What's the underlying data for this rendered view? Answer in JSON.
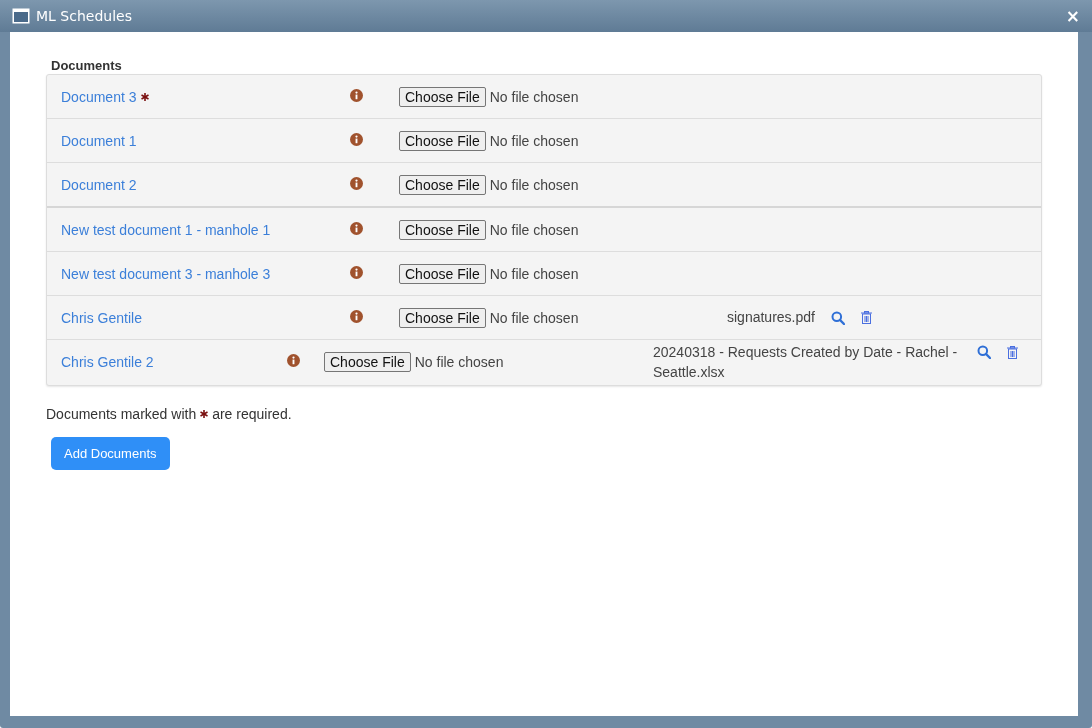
{
  "window": {
    "title": "ML Schedules",
    "close": "×"
  },
  "section_title": "Documents",
  "rows": [
    {
      "kind": "standard",
      "name": "Document 3",
      "required": true,
      "button": "Choose File",
      "status": "No file chosen",
      "group_start": false
    },
    {
      "kind": "standard",
      "name": "Document 1",
      "required": false,
      "button": "Choose File",
      "status": "No file chosen",
      "group_start": false
    },
    {
      "kind": "standard",
      "name": "Document 2",
      "required": false,
      "button": "Choose File",
      "status": "No file chosen",
      "group_start": false
    },
    {
      "kind": "standard",
      "name": "New test document 1 - manhole 1",
      "required": false,
      "button": "Choose File",
      "status": "No file chosen",
      "group_start": true
    },
    {
      "kind": "standard",
      "name": "New test document 3 - manhole 3",
      "required": false,
      "button": "Choose File",
      "status": "No file chosen",
      "group_start": false
    },
    {
      "kind": "standard",
      "name": "Chris Gentile",
      "required": false,
      "button": "Choose File",
      "status": "No file chosen",
      "group_start": false,
      "attachment": "signatures.pdf"
    },
    {
      "kind": "compact",
      "name": "Chris Gentile 2",
      "required": false,
      "button": "Choose File",
      "status": "No file chosen",
      "group_start": false,
      "attachment": "20240318 - Requests Created by Date - Rachel - Seattle.xlsx"
    }
  ],
  "note": {
    "before": "Documents marked with",
    "after": "are required."
  },
  "add_button": "Add Documents"
}
